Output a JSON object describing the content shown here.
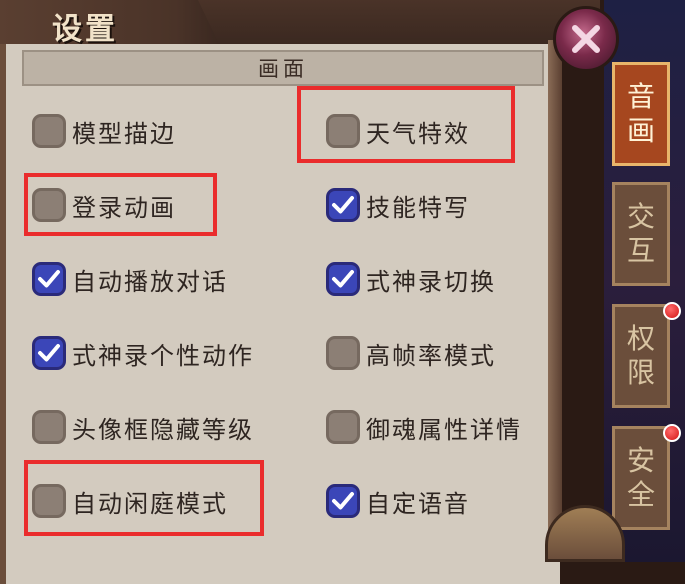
{
  "window": {
    "title": "设置"
  },
  "section": {
    "title": "画面"
  },
  "options": [
    {
      "label": "模型描边",
      "checked": false
    },
    {
      "label": "天气特效",
      "checked": false
    },
    {
      "label": "登录动画",
      "checked": false
    },
    {
      "label": "技能特写",
      "checked": true
    },
    {
      "label": "自动播放对话",
      "checked": true
    },
    {
      "label": "式神录切换",
      "checked": true
    },
    {
      "label": "式神录个性动作",
      "checked": true
    },
    {
      "label": "高帧率模式",
      "checked": false
    },
    {
      "label": "头像框隐藏等级",
      "checked": false
    },
    {
      "label": "御魂属性详情",
      "checked": false
    },
    {
      "label": "自动闲庭模式",
      "checked": false
    },
    {
      "label": "自定语音",
      "checked": true
    }
  ],
  "tabs": [
    {
      "chars": [
        "音",
        "画"
      ],
      "active": true
    },
    {
      "chars": [
        "交",
        "互"
      ],
      "active": false
    },
    {
      "chars": [
        "权",
        "限"
      ],
      "active": false,
      "notification": true
    },
    {
      "chars": [
        "安",
        "全"
      ],
      "active": false,
      "notification": true
    }
  ],
  "colors": {
    "highlight": "#ea2c2c",
    "checked_box": "#3b46b8",
    "panel": "#d3cbbf"
  },
  "icons": {
    "close": "close-x-icon",
    "check": "checkmark-icon"
  }
}
